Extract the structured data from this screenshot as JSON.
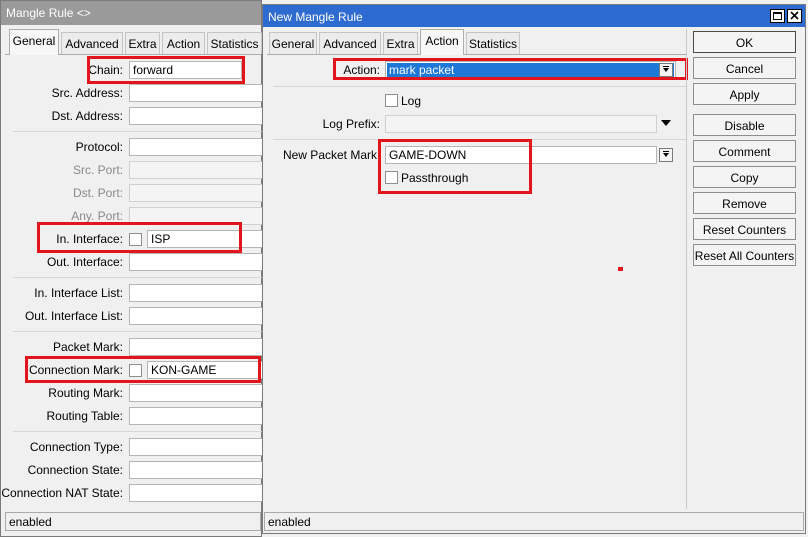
{
  "left_window": {
    "title": "Mangle Rule <>",
    "tabs": [
      "General",
      "Advanced",
      "Extra",
      "Action",
      "Statistics"
    ],
    "fields": {
      "chain_label": "Chain:",
      "chain_value": "forward",
      "src_address": "Src. Address:",
      "dst_address": "Dst. Address:",
      "protocol": "Protocol:",
      "src_port": "Src. Port:",
      "dst_port": "Dst. Port:",
      "any_port": "Any. Port:",
      "in_interface_label": "In. Interface:",
      "in_interface_value": "ISP",
      "out_interface": "Out. Interface:",
      "in_interface_list": "In. Interface List:",
      "out_interface_list": "Out. Interface List:",
      "packet_mark": "Packet Mark:",
      "connection_mark_label": "Connection Mark:",
      "connection_mark_value": "KON-GAME",
      "routing_mark": "Routing Mark:",
      "routing_table": "Routing Table:",
      "connection_type": "Connection Type:",
      "connection_state": "Connection State:",
      "connection_nat_state": "Connection NAT State:"
    },
    "status": "enabled"
  },
  "right_window": {
    "title": "New Mangle Rule",
    "tabs": [
      "General",
      "Advanced",
      "Extra",
      "Action",
      "Statistics"
    ],
    "active_tab": "Action",
    "action_label": "Action:",
    "action_value": "mark packet",
    "log_label": "Log",
    "log_prefix_label": "Log Prefix:",
    "new_packet_mark_label": "New Packet Mark",
    "new_packet_mark_value": "GAME-DOWN",
    "passthrough_label": "Passthrough",
    "status": "enabled",
    "buttons": {
      "ok": "OK",
      "cancel": "Cancel",
      "apply": "Apply",
      "disable": "Disable",
      "comment": "Comment",
      "copy": "Copy",
      "remove": "Remove",
      "reset_counters": "Reset Counters",
      "reset_all_counters": "Reset All Counters"
    }
  },
  "colors": {
    "highlight_red": "#e3141c",
    "titlebar_active": "#2e6bd0",
    "titlebar_inactive": "#9a9a9a",
    "selection_blue": "#1e78d7"
  }
}
